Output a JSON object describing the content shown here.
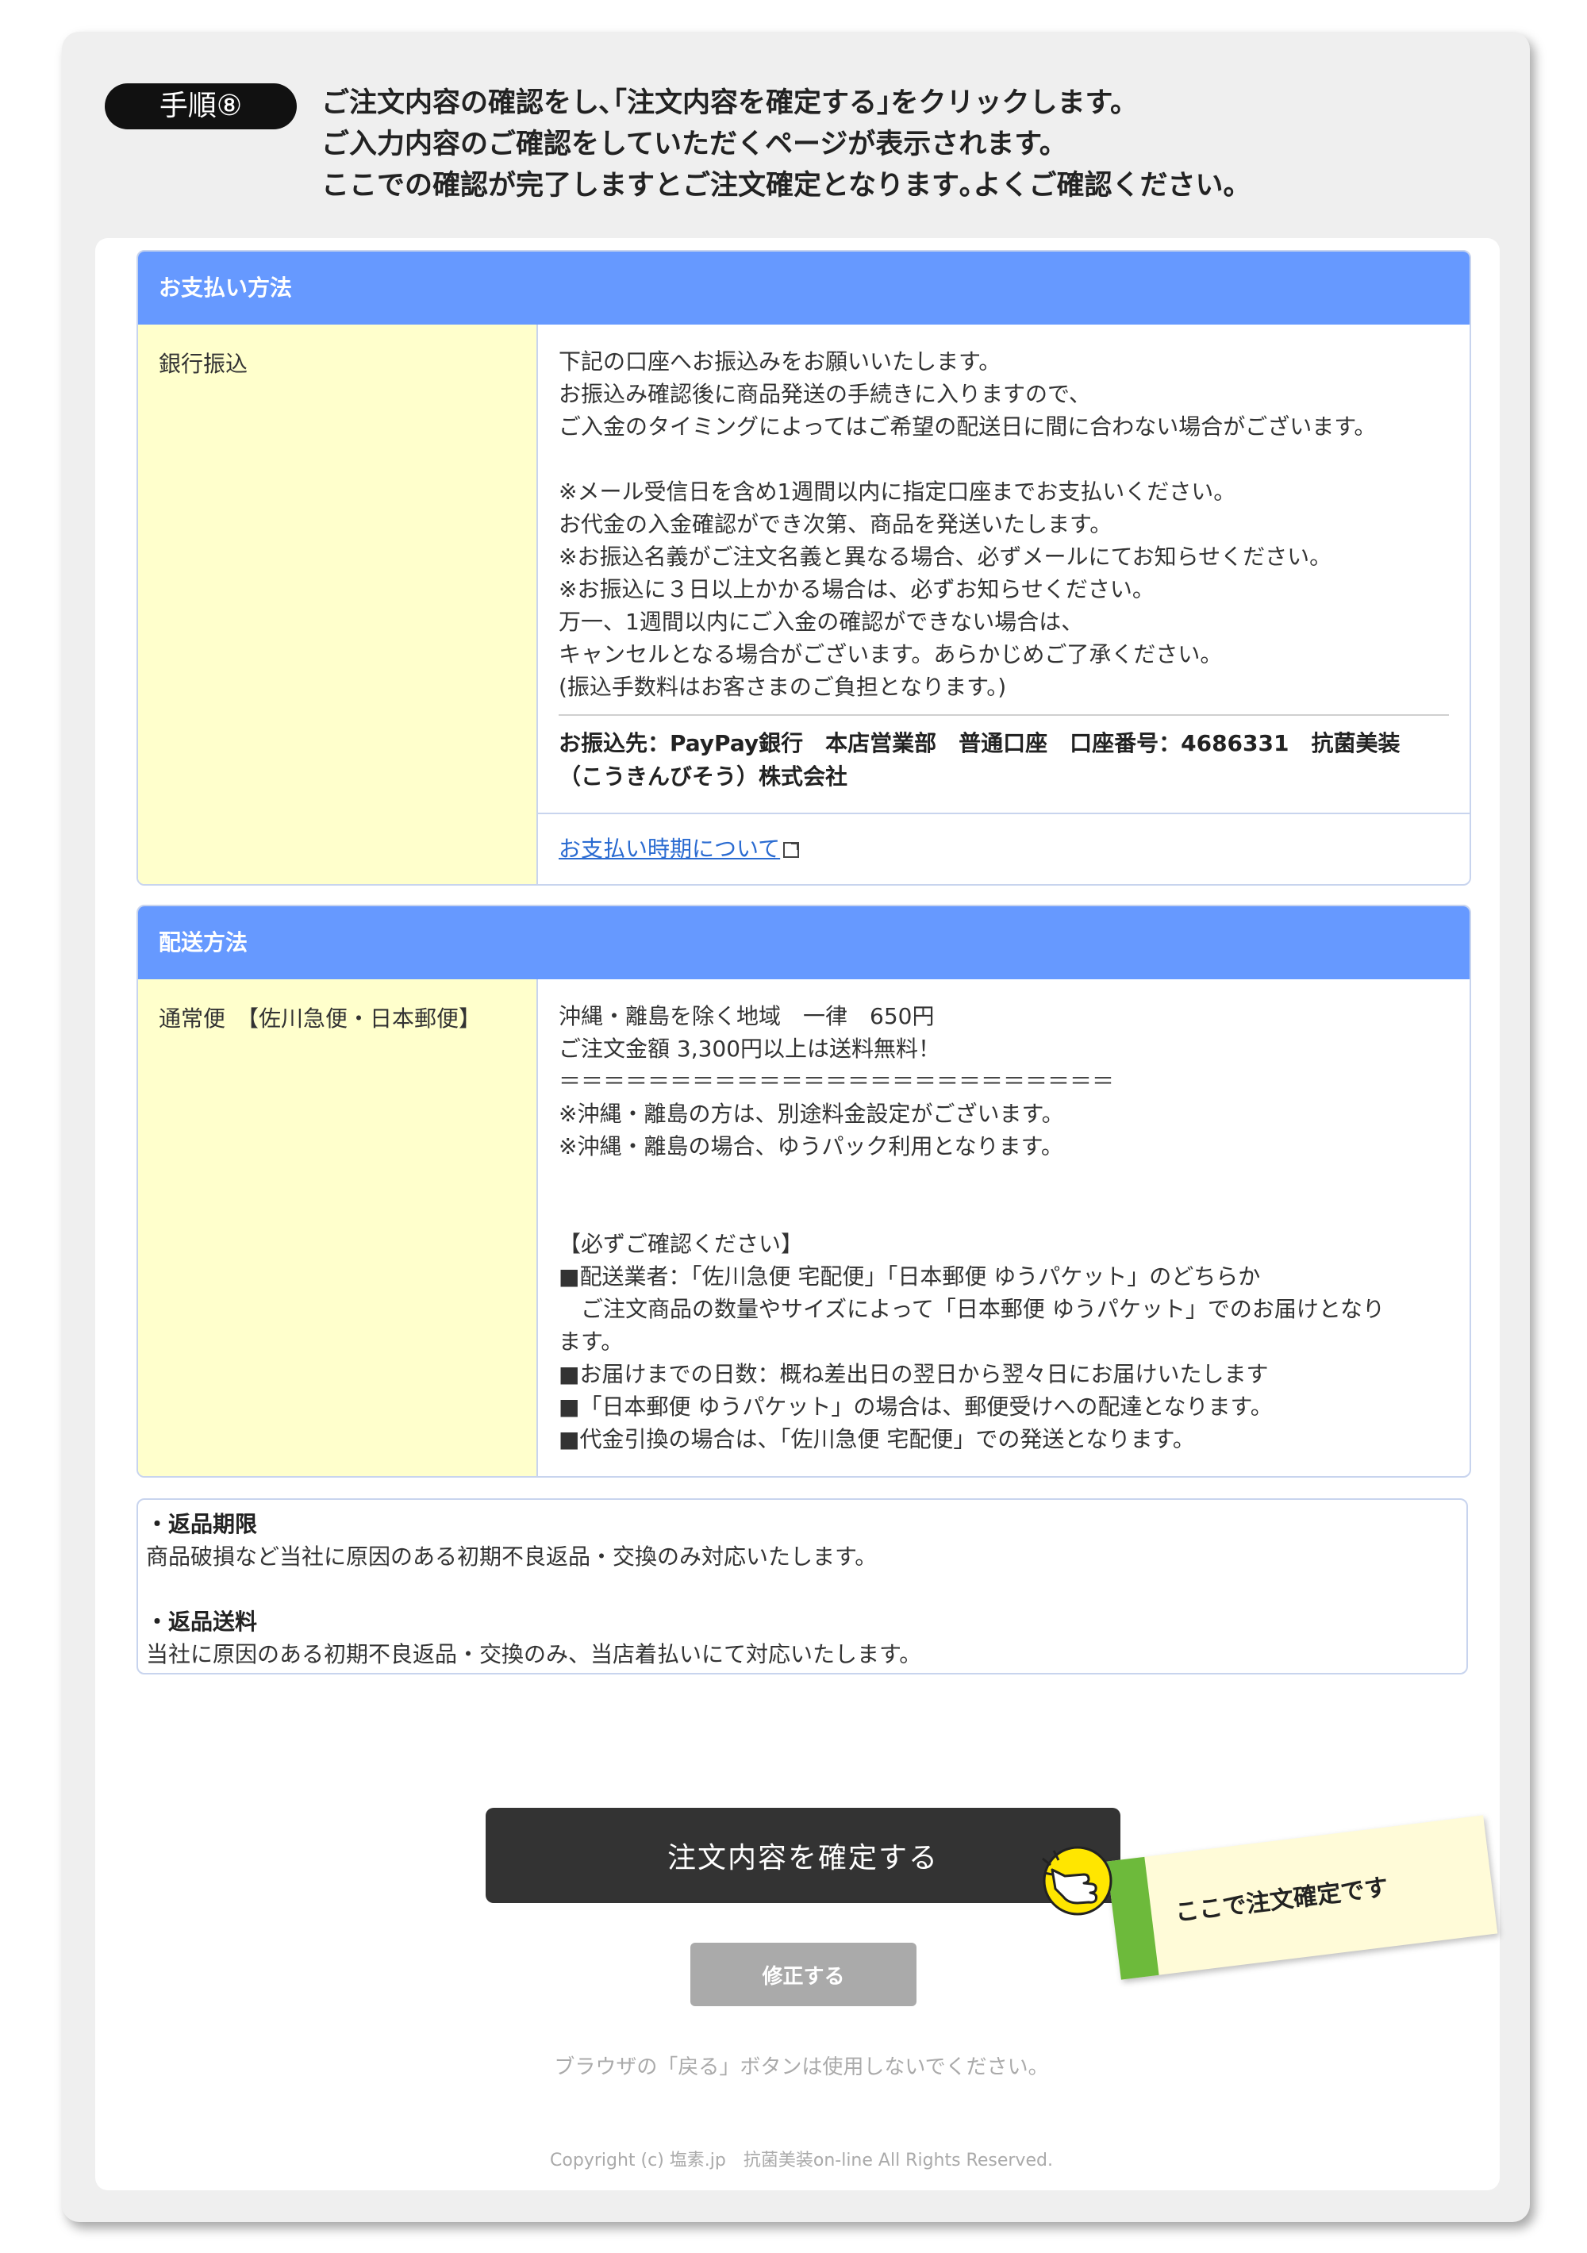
{
  "step": {
    "badge": "手順⑧",
    "lines": [
      "ご注文内容の確認をし､｢注文内容を確定する｣をクリックします。",
      "ご入力内容のご確認をしていただくページが表示されます。",
      "ここでの確認が完了しますとご注文確定となります｡よくご確認ください。"
    ]
  },
  "payment": {
    "header": "お支払い方法",
    "label": "銀行振込",
    "lines": [
      "下記の口座へお振込みをお願いいたします。",
      "お振込み確認後に商品発送の手続きに入りますので、",
      "ご入金のタイミングによってはご希望の配送日に間に合わない場合がございます。",
      "",
      "※メール受信日を含め1週間以内に指定口座までお支払いください。",
      "お代金の入金確認ができ次第、商品を発送いたします。",
      "※お振込名義がご注文名義と異なる場合、必ずメールにてお知らせください。",
      "※お振込に３日以上かかる場合は、必ずお知らせください。",
      "万一、1週間以内にご入金の確認ができない場合は、",
      "キャンセルとなる場合がございます。あらかじめご了承ください。",
      "(振込手数料はお客さまのご負担となります。)"
    ],
    "account_line1": "お振込先：PayPay銀行　本店営業部　普通口座　口座番号：4686331　抗菌美装",
    "account_line2": "（こうきんびそう）株式会社",
    "link": "お支払い時期について"
  },
  "shipping": {
    "header": "配送方法",
    "label": "通常便　【佐川急便・日本郵便】",
    "lines": [
      "沖縄・離島を除く地域　一律　650円",
      "ご注文金額 3,300円以上は送料無料！",
      "＝＝＝＝＝＝＝＝＝＝＝＝＝＝＝＝＝＝＝＝＝＝＝＝＝",
      "※沖縄・離島の方は、別途料金設定がございます。",
      "※沖縄・離島の場合、ゆうパック利用となります。",
      "",
      "",
      "【必ずご確認ください】",
      "■配送業者：｢佐川急便 宅配便｣「日本郵便 ゆうパケット」のどちらか",
      "　ご注文商品の数量やサイズによって「日本郵便 ゆうパケット」でのお届けとなり",
      "ます。",
      "■お届けまでの日数：概ね差出日の翌日から翌々日にお届けいたします",
      "■「日本郵便 ゆうパケット」の場合は、郵便受けへの配達となります。",
      "■代金引換の場合は、「佐川急便 宅配便」での発送となります。"
    ]
  },
  "returns": {
    "period_title": "・返品期限",
    "period_text": "商品破損など当社に原因のある初期不良返品・交換のみ対応いたします。",
    "shipping_title": "・返品送料",
    "shipping_text": "当社に原因のある初期不良返品・交換のみ、当店着払いにて対応いたします。"
  },
  "buttons": {
    "confirm": "注文内容を確定する",
    "fix": "修正する"
  },
  "sticky_note": "ここで注文確定です",
  "notice": "ブラウザの「戻る」ボタンは使用しないでください。",
  "copyright": "Copyright (c) 塩素.jp　抗菌美装on-line All Rights Reserved.",
  "colors": {
    "header_blue": "#6699ff",
    "label_yellow": "#ffffcc",
    "confirm_button": "#333333",
    "fix_button": "#aaaaaa",
    "sticky_tab_green": "#6dba3b"
  }
}
